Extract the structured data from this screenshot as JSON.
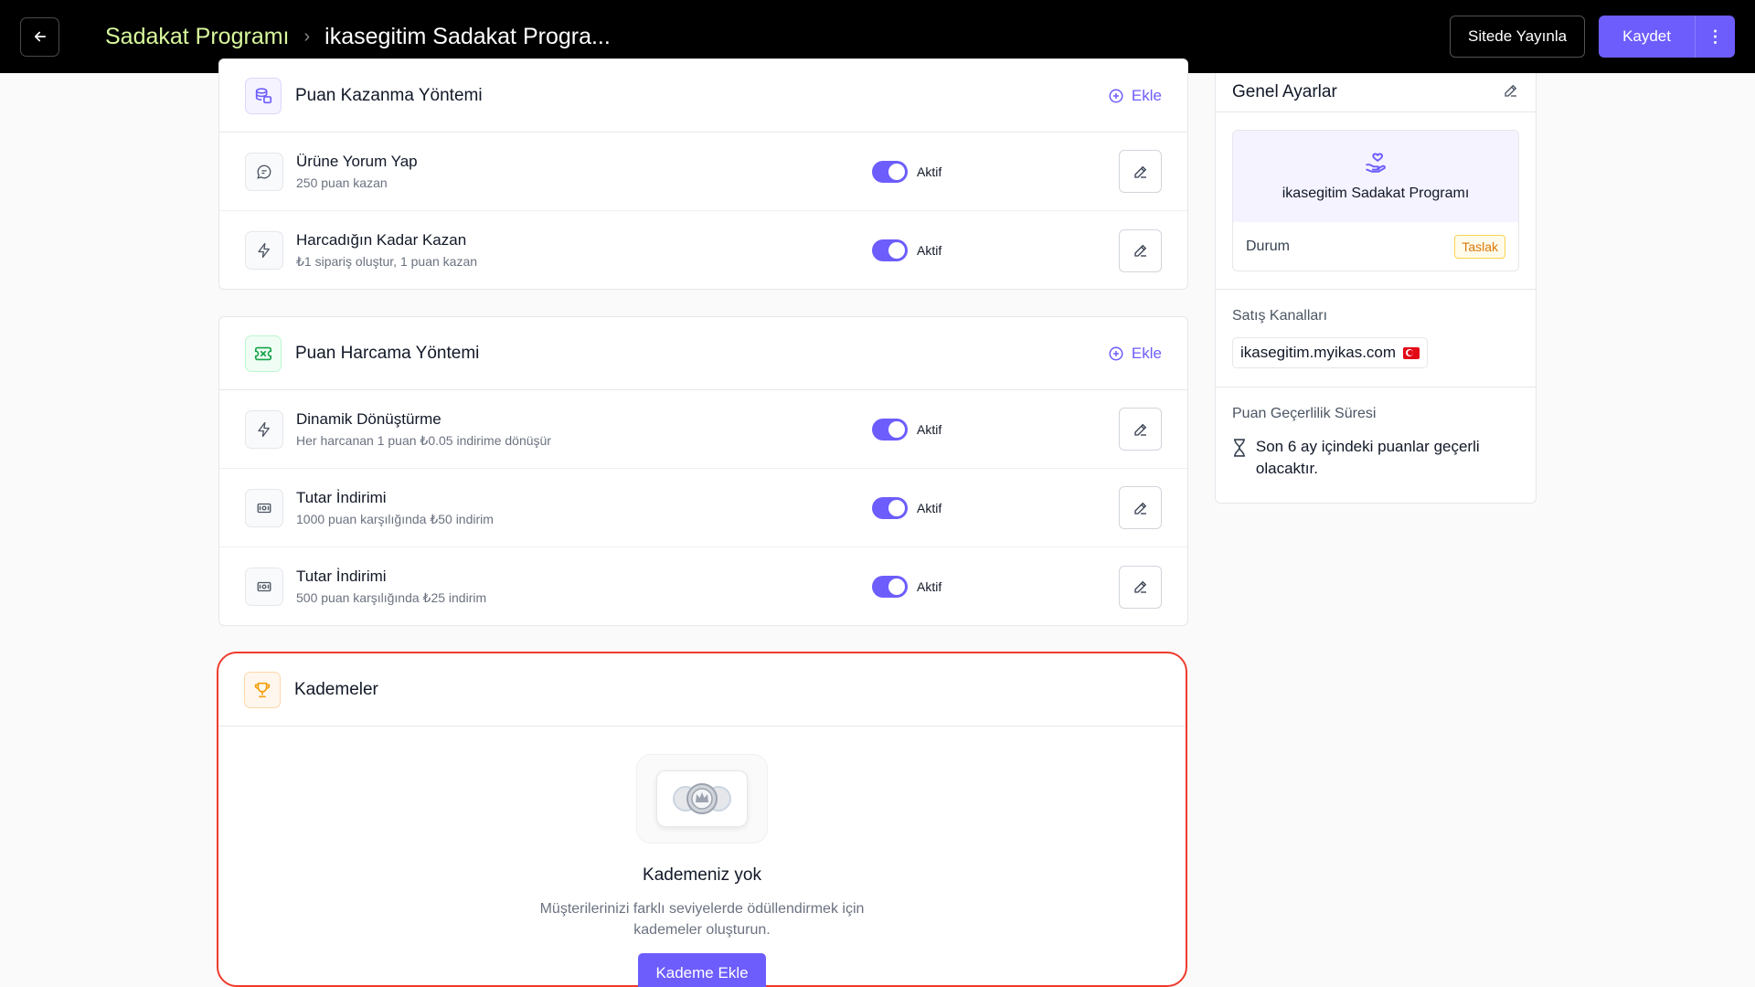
{
  "header": {
    "breadcrumb_root": "Sadakat Programı",
    "breadcrumb_current": "ikasegitim Sadakat Progra...",
    "publish_label": "Sitede Yayınla",
    "save_label": "Kaydet"
  },
  "earning": {
    "title": "Puan Kazanma Yöntemi",
    "add_label": "Ekle",
    "items": [
      {
        "title": "Ürüne Yorum Yap",
        "subtitle": "250 puan kazan",
        "status": "Aktif",
        "icon": "comment-icon"
      },
      {
        "title": "Harcadığın Kadar Kazan",
        "subtitle": "₺1 sipariş oluştur, 1 puan kazan",
        "status": "Aktif",
        "icon": "lightning-icon"
      }
    ]
  },
  "spending": {
    "title": "Puan Harcama Yöntemi",
    "add_label": "Ekle",
    "items": [
      {
        "title": "Dinamik Dönüştürme",
        "subtitle": "Her harcanan 1 puan ₺0.05 indirime dönüşür",
        "status": "Aktif",
        "icon": "lightning-icon"
      },
      {
        "title": "Tutar İndirimi",
        "subtitle": "1000 puan karşılığında ₺50 indirim",
        "status": "Aktif",
        "icon": "banknote-icon"
      },
      {
        "title": "Tutar İndirimi",
        "subtitle": "500 puan karşılığında ₺25 indirim",
        "status": "Aktif",
        "icon": "banknote-icon"
      }
    ]
  },
  "tiers": {
    "title": "Kademeler",
    "empty_title": "Kademeniz yok",
    "empty_desc": "Müşterilerinizi farklı seviyelerde ödüllendirmek için kademeler oluşturun.",
    "add_button": "Kademe Ekle"
  },
  "settings": {
    "title": "Genel Ayarlar",
    "program_name": "ikasegitim Sadakat Programı",
    "status_label": "Durum",
    "status_value": "Taslak",
    "channels_label": "Satış Kanalları",
    "channel": "ikasegitim.myikas.com",
    "validity_label": "Puan Geçerlilik Süresi",
    "validity_text": "Son 6 ay içindeki puanlar geçerli olacaktır."
  },
  "colors": {
    "accent": "#6d5dfc",
    "breadcrumb_root": "#d9f99d",
    "highlight_border": "#ef3b2d",
    "draft_badge": "#d97706"
  }
}
